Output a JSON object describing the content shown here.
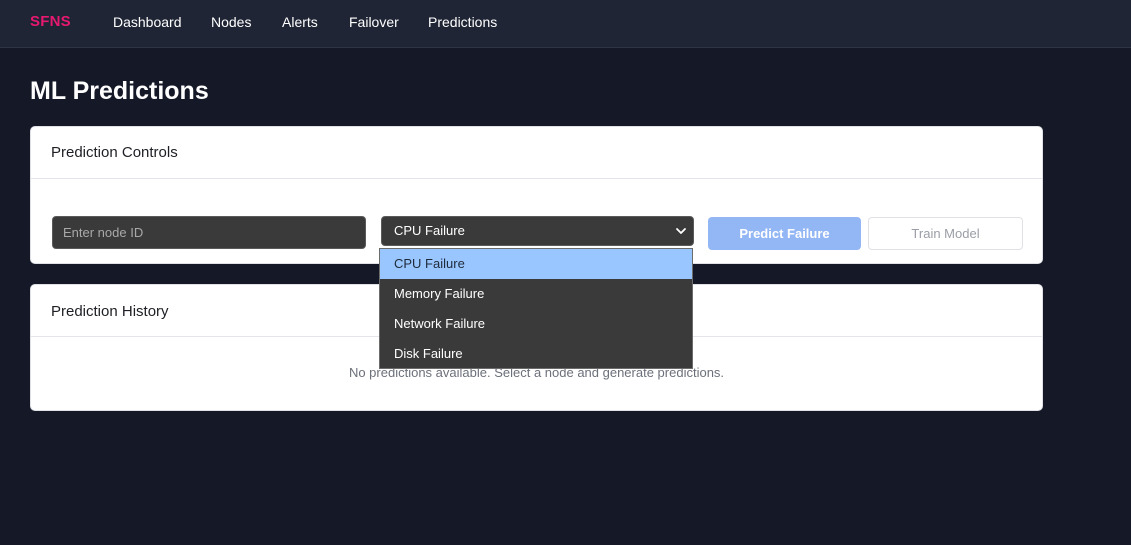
{
  "navbar": {
    "brand": "SFNS",
    "links": [
      "Dashboard",
      "Nodes",
      "Alerts",
      "Failover",
      "Predictions"
    ]
  },
  "page": {
    "title": "ML Predictions"
  },
  "controls": {
    "title": "Prediction Controls",
    "node_input": {
      "value": "",
      "placeholder": "Enter node ID"
    },
    "failure_select": {
      "value": "CPU Failure",
      "options": [
        "CPU Failure",
        "Memory Failure",
        "Network Failure",
        "Disk Failure"
      ],
      "open": true
    },
    "predict_label": "Predict Failure",
    "train_label": "Train Model"
  },
  "history": {
    "title": "Prediction History",
    "empty_message": "No predictions available. Select a node and generate predictions."
  },
  "colors": {
    "background": "#141827",
    "navbar": "#1f2535",
    "brand": "#e6196e",
    "predict_button": "#93b6f4",
    "selected_option": "#9ac6ff"
  }
}
